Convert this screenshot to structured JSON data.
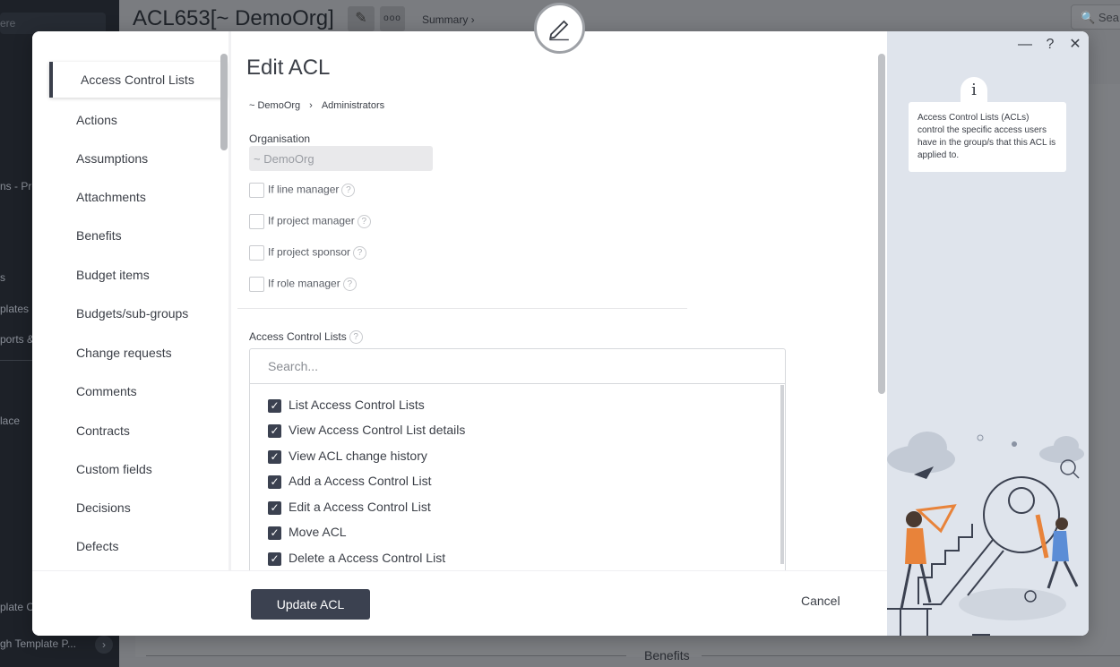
{
  "background": {
    "sidebar_items": [
      "ere",
      "ns - Pro",
      "s",
      "plates",
      "ports &",
      "lace",
      "plate C",
      "gh Template P..."
    ],
    "page_title": "ACL653[~ DemoOrg]",
    "summary_label": "Summary ›",
    "search_label": "Sea",
    "section_label": "Benefits"
  },
  "nav": {
    "items": [
      "Access Control Lists",
      "Actions",
      "Assumptions",
      "Attachments",
      "Benefits",
      "Budget items",
      "Budgets/sub-groups",
      "Change requests",
      "Comments",
      "Contracts",
      "Custom fields",
      "Decisions",
      "Defects"
    ]
  },
  "form": {
    "title": "Edit ACL",
    "breadcrumb": [
      "~ DemoOrg",
      "Administrators"
    ],
    "organisation_label": "Organisation",
    "organisation_value": "~ DemoOrg",
    "checkboxes": [
      "If line manager",
      "If project manager",
      "If project sponsor",
      "If role manager"
    ],
    "acl_label": "Access Control Lists",
    "search_placeholder": "Search...",
    "acl_items": [
      "List Access Control Lists",
      "View Access Control List details",
      "View ACL change history",
      "Add a Access Control List",
      "Edit a Access Control List",
      "Move ACL",
      "Delete a Access Control List"
    ]
  },
  "footer": {
    "update_label": "Update ACL",
    "cancel_label": "Cancel"
  },
  "help_panel": {
    "text": "Access Control Lists (ACLs) control the specific access users have in the group/s that this ACL is applied to.",
    "info_glyph": "i",
    "controls": [
      "—",
      "?",
      "✕"
    ]
  },
  "colors": {
    "primary": "#3b4150",
    "panel_bg": "#dfe4ec",
    "accent_orange": "#e8833a"
  }
}
